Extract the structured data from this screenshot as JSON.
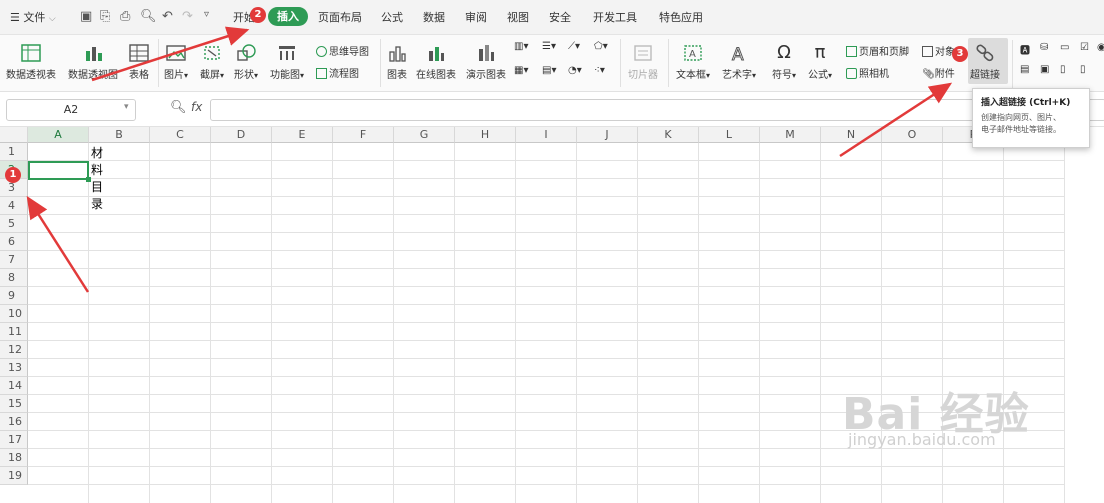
{
  "menubar": {
    "file_label": "文件",
    "tabs": [
      "开始",
      "插入",
      "页面布局",
      "公式",
      "数据",
      "审阅",
      "视图",
      "安全",
      "开发工具",
      "特色应用"
    ],
    "active_tab": "插入"
  },
  "ribbon": {
    "pivot_table": "数据透视表",
    "pivot_chart": "数据透视图",
    "table": "表格",
    "picture": "图片",
    "screenshot": "截屏",
    "shape": "形状",
    "function_chart": "功能图",
    "mindmap": "思维导图",
    "flowchart": "流程图",
    "chart": "图表",
    "online_chart": "在线图表",
    "demo_chart": "演示图表",
    "slicer": "切片器",
    "textbox": "文本框",
    "wordart": "艺术字",
    "symbol": "符号",
    "formula": "公式",
    "header_footer": "页眉和页脚",
    "object": "对象",
    "camera": "照相机",
    "attachment": "附件",
    "hyperlink": "超链接"
  },
  "formula_bar": {
    "name_box": "A2",
    "fx_label": "fx",
    "content": ""
  },
  "columns": [
    "A",
    "B",
    "C",
    "D",
    "E",
    "F",
    "G",
    "H",
    "I",
    "J",
    "K",
    "L",
    "M",
    "N",
    "O",
    "P",
    "Q"
  ],
  "rows": [
    "1",
    "2",
    "3",
    "4",
    "5",
    "6",
    "7",
    "8",
    "9",
    "10",
    "11",
    "12",
    "13",
    "14",
    "15",
    "16",
    "17",
    "18",
    "19"
  ],
  "cells": {
    "B1": "材料目录"
  },
  "tooltip": {
    "title": "插入超链接 (Ctrl+K)",
    "desc_line1": "创建指向网页、图片、",
    "desc_line2": "电子邮件地址等链接。"
  },
  "annotations": [
    "1",
    "2",
    "3"
  ],
  "watermark": {
    "text": "Bai 经验",
    "url": "jingyan.baidu.com"
  },
  "colors": {
    "accent": "#2e9b55",
    "arrow": "#e23a3a"
  }
}
